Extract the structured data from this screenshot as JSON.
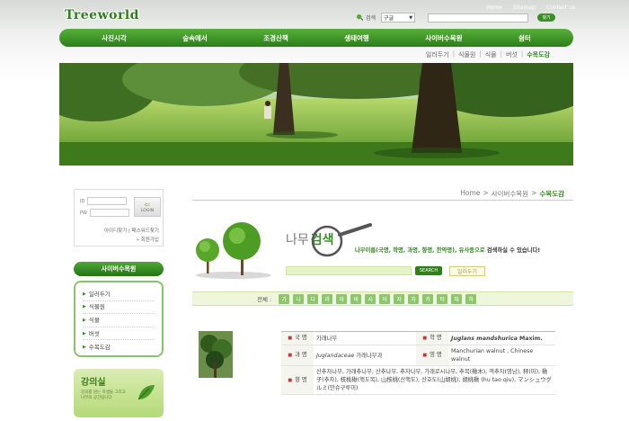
{
  "header": {
    "logo": "Treeworld",
    "top_links": [
      "Home",
      "Sitemap",
      "Contact us"
    ],
    "search_label": "검색",
    "search_select": "구글",
    "search_button": "찾기"
  },
  "nav": {
    "items": [
      "사진시각",
      "숲속에서",
      "조경산책",
      "생태여행",
      "사이버수목원",
      "쉼터"
    ]
  },
  "subnav": {
    "items": [
      "일러두기",
      "식물원",
      "식물",
      "버섯",
      "수목도감"
    ]
  },
  "login": {
    "id_label": "ID",
    "pw_label": "PW",
    "button": "LOGIN",
    "link_find": "아이디찾기 | 패스워드찾기",
    "link_join": "» 회원가입"
  },
  "sidebar": {
    "title": "사이버수목원",
    "items": [
      "일러두기",
      "식물원",
      "식물",
      "버섯",
      "수목도감"
    ]
  },
  "lecture": {
    "title": "강의실",
    "desc": "강의를 원는 학생들 그리고 나무의 공간입니다"
  },
  "breadcrumb": {
    "home": "Home",
    "section": "사이버수목원",
    "current": "수목도감"
  },
  "tree_search": {
    "title_prefix": "나무",
    "title_em": "검색",
    "tip_highlight": "나무이름(국명, 학명, 과명, 향명, 한약명), 유사종으로",
    "tip_rest": "검색하실 수 있습니다!",
    "search_button": "SEARCH",
    "detail_button": "일러두기"
  },
  "index": {
    "label": "전체 :",
    "keys": [
      "가",
      "나",
      "다",
      "라",
      "마",
      "바",
      "사",
      "아",
      "자",
      "차",
      "카",
      "타",
      "파",
      "하"
    ]
  },
  "info": {
    "korean_name_label": "국 명",
    "korean_name": "가래나무",
    "scientific_label": "학 명",
    "scientific_name": "Juglans mandshurica",
    "scientific_author": "Maxim.",
    "family_label": "과 명",
    "family_latin": "Juglandaceae",
    "family_korean": "가래나무과",
    "english_label": "영 명",
    "english_name": "Manchurian walnut , Chinese walnut",
    "local_label": "향 명",
    "local_names": "산추자나무, 가래추나무, 산추나무, 추자나무, 가래로시나무, 추목(楸木), 객추자(영남), 秤(마), 楸子(추자), 核桃楸(핵도목), 山核桃(산핵도), 산호도(山胡桃), 胡桃楸 (hu tao qiu), マンシュウグルミ(만슈구루미)"
  }
}
